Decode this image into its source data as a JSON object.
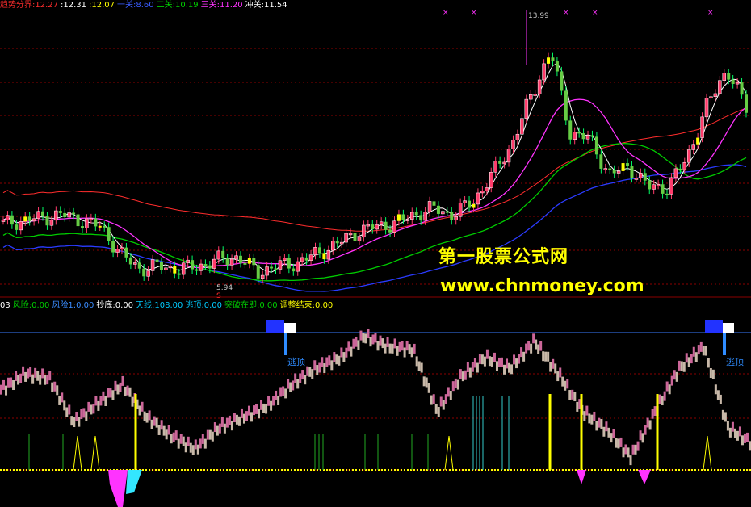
{
  "upper_legend": [
    {
      "text": "趋势分界:12.27",
      "color": "#ff2d2d"
    },
    {
      "text": ":12.31",
      "color": "#ffffff"
    },
    {
      "text": ":12.07",
      "color": "#ffff00"
    },
    {
      "text": "一关:8.60",
      "color": "#3a5cff"
    },
    {
      "text": "二关:10.19",
      "color": "#00cc00"
    },
    {
      "text": "三关:11.20",
      "color": "#ff33ff"
    },
    {
      "text": "冲关:11.54",
      "color": "#ffffff"
    }
  ],
  "lower_legend": [
    {
      "text": "03",
      "color": "#ffffff"
    },
    {
      "text": "风险:0.00",
      "color": "#00cc00"
    },
    {
      "text": "风险1:0.00",
      "color": "#3a8cff"
    },
    {
      "text": "抄底:0.00",
      "color": "#ffffff"
    },
    {
      "text": "天线:108.00",
      "color": "#00ccff"
    },
    {
      "text": "逃顶:0.00",
      "color": "#00ccff"
    },
    {
      "text": "突破在即:0.00",
      "color": "#00cc00"
    },
    {
      "text": "调整结束:0.00",
      "color": "#ffff00"
    }
  ],
  "price_labels": {
    "high": "13.99",
    "low": "5.94"
  },
  "signal_labels": {
    "escape_top": "逃顶",
    "s_mark": "S"
  },
  "watermark": {
    "line1": "第一股票公式网",
    "line2": "www.chnmoney.com"
  },
  "colors": {
    "up": "#ff3b6b",
    "down": "#00ffff",
    "bg": "#000000",
    "grid": "#8b0000",
    "ma1": "#ffffff",
    "ma2": "#ff33ff",
    "ma3": "#00cc00",
    "ma4": "#2b3bff",
    "trend": "#ff2d2d",
    "osc_rise": "#cc6699",
    "osc_fall": "#c8b8a8"
  },
  "chart_data": {
    "type": "candlestick",
    "price_points": [
      7.6,
      7.7,
      7.8,
      7.9,
      7.7,
      7.5,
      6.6,
      6.1,
      6.2,
      6.1,
      6.2,
      6.4,
      6.5,
      6.0,
      6.2,
      6.3,
      6.6,
      6.9,
      7.3,
      7.5,
      7.6,
      7.9,
      8.1,
      7.9,
      8.3,
      9.2,
      10.2,
      11.8,
      13.3,
      10.6,
      10.4,
      9.2,
      9.5,
      8.8,
      8.8,
      9.8,
      11.5,
      12.7,
      11.4
    ],
    "oscillator": [
      20,
      26,
      24,
      8,
      15,
      22,
      10,
      3,
      -2,
      6,
      10,
      14,
      22,
      28,
      32,
      40,
      36,
      35,
      12,
      25,
      32,
      28,
      38,
      26,
      12,
      5,
      -5,
      12,
      28,
      36,
      6,
      0
    ]
  }
}
